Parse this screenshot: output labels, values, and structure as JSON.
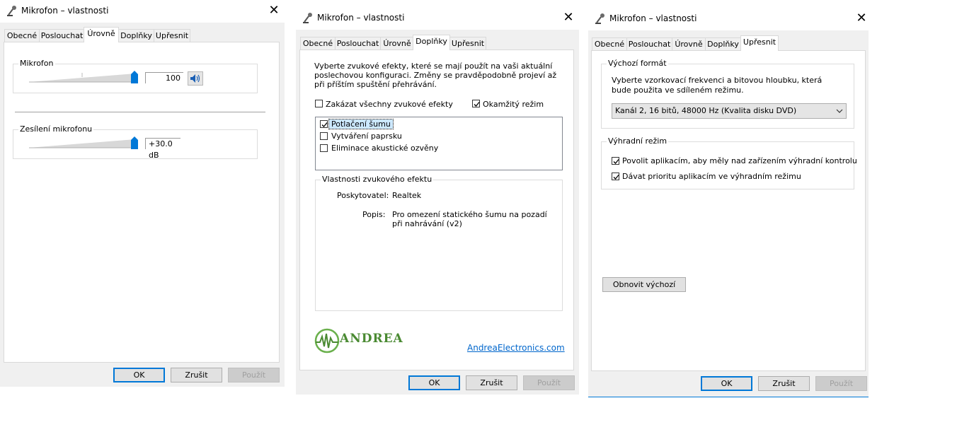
{
  "windows": [
    {
      "title": "Mikrofon – vlastnosti",
      "tabs": [
        "Obecné",
        "Poslouchat",
        "Úrovně",
        "Doplňky",
        "Upřesnit"
      ],
      "active_tab": "Úrovně",
      "levels": {
        "microphone": {
          "label": "Mikrofon",
          "value": "100",
          "level": 1.0
        },
        "boost": {
          "label": "Zesílení mikrofonu",
          "value": "+30.0 dB",
          "level": 1.0
        }
      },
      "buttons": {
        "ok": "OK",
        "cancel": "Zrušit",
        "apply": "Použít"
      }
    },
    {
      "title": "Mikrofon – vlastnosti",
      "tabs": [
        "Obecné",
        "Poslouchat",
        "Úrovně",
        "Doplňky",
        "Upřesnit"
      ],
      "active_tab": "Doplňky",
      "intro": "Vyberte zvukové efekty, které se mají použít na vaši aktuální poslechovou konfiguraci. Změny se pravděpodobně projeví až při příštím spuštění přehrávání.",
      "disable_all": {
        "label": "Zakázat všechny zvukové efekty",
        "checked": false
      },
      "immediate_mode": {
        "label": "Okamžitý režim",
        "checked": true
      },
      "effects": [
        {
          "label": "Potlačení šumu",
          "checked": true,
          "selected": true
        },
        {
          "label": "Vytváření paprsku",
          "checked": false,
          "selected": false
        },
        {
          "label": "Eliminace akustické ozvěny",
          "checked": false,
          "selected": false
        }
      ],
      "properties": {
        "legend": "Vlastnosti zvukového efektu",
        "provider_label": "Poskytovatel:",
        "provider_value": "Realtek",
        "description_label": "Popis:",
        "description_value": "Pro omezení statického šumu na pozadí při nahrávání (v2)"
      },
      "logo_text": "ANDREA",
      "link": "AndreaElectronics.com",
      "buttons": {
        "ok": "OK",
        "cancel": "Zrušit",
        "apply": "Použít"
      }
    },
    {
      "title": "Mikrofon – vlastnosti",
      "tabs": [
        "Obecné",
        "Poslouchat",
        "Úrovně",
        "Doplňky",
        "Upřesnit"
      ],
      "active_tab": "Upřesnit",
      "default_format": {
        "legend": "Výchozí formát",
        "description": "Vyberte vzorkovací frekvenci a bitovou hloubku, která bude použita ve sdíleném režimu.",
        "selected": "Kanál 2, 16 bitů, 48000 Hz (Kvalita disku DVD)"
      },
      "exclusive_mode": {
        "legend": "Výhradní režim",
        "options": [
          {
            "label": "Povolit aplikacím, aby měly nad zařízením výhradní kontrolu",
            "checked": true
          },
          {
            "label": "Dávat prioritu aplikacím ve výhradním režimu",
            "checked": true
          }
        ]
      },
      "restore_default": "Obnovit výchozí",
      "buttons": {
        "ok": "OK",
        "cancel": "Zrušit",
        "apply": "Použít"
      }
    }
  ],
  "colors": {
    "accent": "#0078d7",
    "slider": "#0078d7",
    "link": "#0066cc",
    "selection": "#cce8ff"
  },
  "icons": {
    "title": "microphone-icon",
    "close": "close-icon",
    "speaker": "speaker-icon",
    "check": "check-icon",
    "dropdown": "chevron-down-icon"
  }
}
